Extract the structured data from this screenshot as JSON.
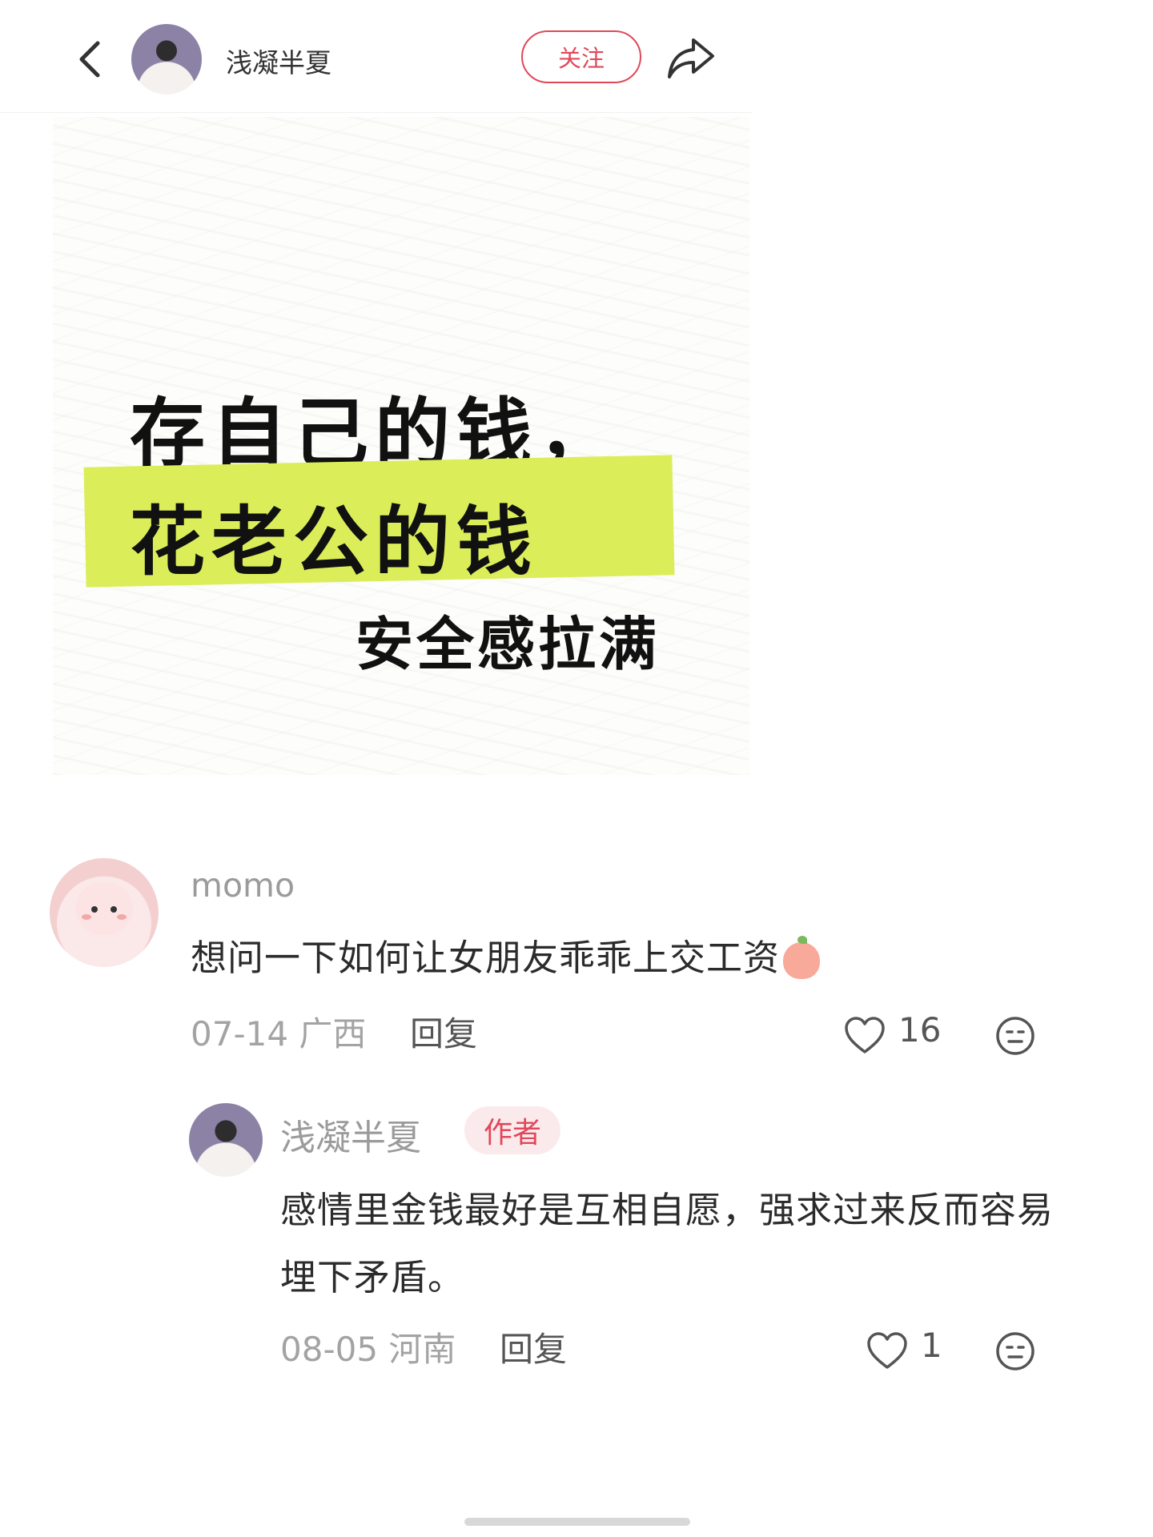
{
  "header": {
    "author": "浅凝半夏",
    "follow_label": "关注"
  },
  "note": {
    "line1": "存自己的钱，",
    "line2": "花老公的钱",
    "line3": "安全感拉满",
    "highlight_color": "#dbee5a"
  },
  "comment": {
    "user": "momo",
    "text": "想问一下如何让女朋友乖乖上交工资",
    "date_location": "07-14 广西",
    "reply_label": "回复",
    "likes": "16"
  },
  "reply": {
    "user": "浅凝半夏",
    "badge": "作者",
    "text": "感情里金钱最好是互相自愿，强求过来反而容易埋下矛盾。",
    "date_location": "08-05 河南",
    "reply_label": "回复",
    "likes": "1"
  },
  "colors": {
    "accent": "#e0485a",
    "muted_text": "#a3a3a3"
  },
  "icons": [
    "back-arrow-icon",
    "share-icon",
    "heart-icon",
    "emoji-icon",
    "peach-emoji-icon"
  ]
}
